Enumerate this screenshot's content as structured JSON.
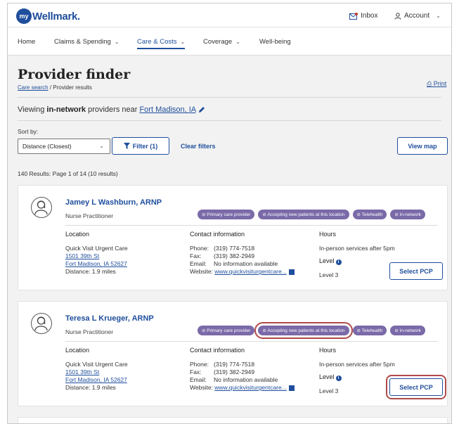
{
  "brand": {
    "logo_mark": "my",
    "logo_text": "Wellmark."
  },
  "topbar": {
    "inbox": "Inbox",
    "account": "Account",
    "inbox_icon": "mail-icon",
    "account_icon": "user-icon"
  },
  "nav": {
    "items": [
      {
        "label": "Home",
        "has_menu": false
      },
      {
        "label": "Claims & Spending",
        "has_menu": true
      },
      {
        "label": "Care & Costs",
        "has_menu": true,
        "active": true
      },
      {
        "label": "Coverage",
        "has_menu": true
      },
      {
        "label": "Well-being",
        "has_menu": false
      }
    ]
  },
  "page": {
    "title": "Provider finder",
    "breadcrumb_link": "Care search",
    "breadcrumb_current": " / Provider results",
    "print": "Print"
  },
  "viewing": {
    "prefix": "Viewing ",
    "bold": "in-network",
    "middle": " providers near ",
    "location": "Fort Madison, IA"
  },
  "controls": {
    "sort_label": "Sort by:",
    "sort_value": "Distance (Closest)",
    "filter": "Filter (1)",
    "clear": "Clear filters",
    "view_map": "View map"
  },
  "results_summary": "140 Results: Page 1 of 14 (10 results)",
  "headers": {
    "location": "Location",
    "contact": "Contact information",
    "hours": "Hours",
    "level": "Level"
  },
  "providers": [
    {
      "name": "Jamey L Washburn, ARNP",
      "role": "Nurse Practitioner",
      "badges": [
        "Primary care provider",
        "Accepting new patients at this location",
        "Telehealth",
        "In-network"
      ],
      "location_name": "Quick Visit Urgent Care",
      "address1": "1501 39th St",
      "address2": "Fort Madison, IA 52627",
      "distance": "Distance: 1.9 miles",
      "phone_label": "Phone:",
      "phone": "(319) 774-7518",
      "fax_label": "Fax:",
      "fax": "(319) 382-2949",
      "email_label": "Email:",
      "email": "No information available",
      "website_label": "Website:",
      "website": "www.quickvisiturgentcare...",
      "hours": "In-person services after 5pm",
      "level": "Level 3",
      "select": "Select PCP"
    },
    {
      "name": "Teresa L Krueger, ARNP",
      "role": "Nurse Practitioner",
      "badges": [
        "Primary care provider",
        "Accepting new patients at this location",
        "Telehealth",
        "In-network"
      ],
      "location_name": "Quick Visit Urgent Care",
      "address1": "1501 39th St",
      "address2": "Fort Madison, IA 52627",
      "distance": "Distance: 1.9 miles",
      "phone_label": "Phone:",
      "phone": "(319) 774-7518",
      "fax_label": "Fax:",
      "fax": "(319) 382-2949",
      "email_label": "Email:",
      "email": "No information available",
      "website_label": "Website:",
      "website": "www.quickvisiturgentcare...",
      "hours": "In-person services after 5pm",
      "level": "Level 3",
      "select": "Select PCP"
    }
  ],
  "colors": {
    "brand_blue": "#1f4e9c",
    "badge_purple": "#7a6aa8",
    "highlight_red": "#b04a4a"
  }
}
